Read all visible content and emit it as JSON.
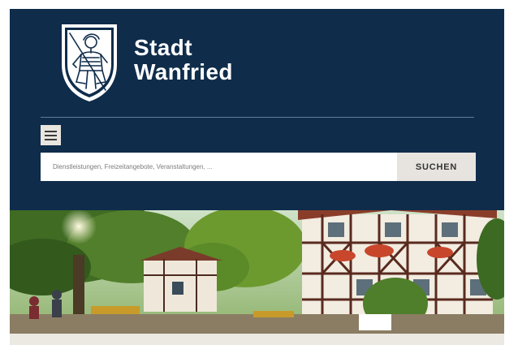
{
  "header": {
    "logo_line1": "Stadt",
    "logo_line2": "Wanfried",
    "crest_icon": "city-coat-of-arms-icon",
    "background_color": "#0f2c4b"
  },
  "menu": {
    "icon": "hamburger-menu-icon"
  },
  "search": {
    "placeholder": "Dienstleistungen, Freizeitangebote, Veranstaltungen, ...",
    "button_label": "SUCHEN"
  },
  "hero": {
    "image": "half-timbered-town-square-photo"
  }
}
